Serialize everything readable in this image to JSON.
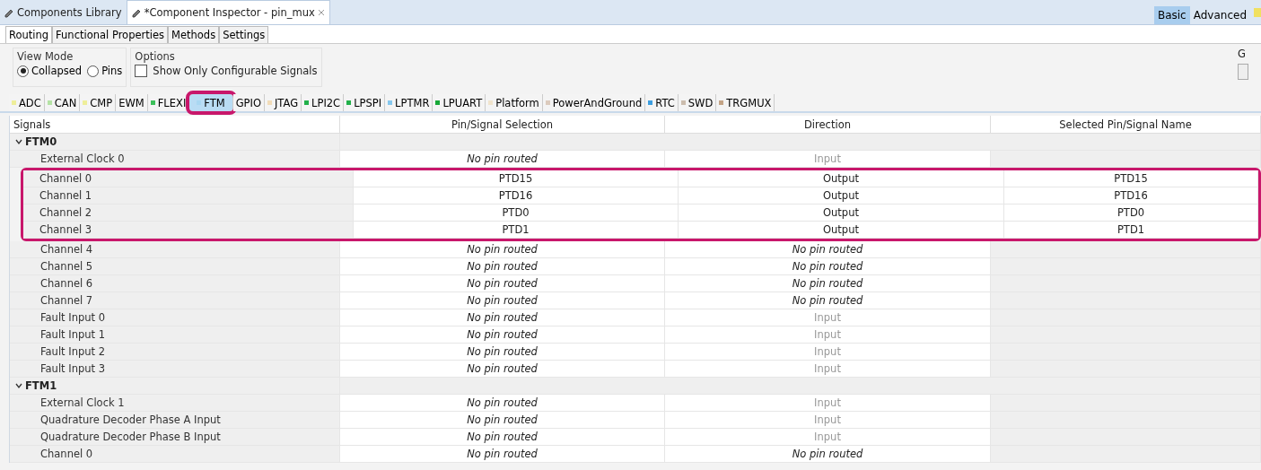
{
  "editor_tabs": [
    {
      "label": "Components Library",
      "selected": false,
      "closable": false
    },
    {
      "label": "*Component Inspector - pin_mux",
      "selected": true,
      "closable": true
    }
  ],
  "mode_buttons": [
    {
      "label": "Basic",
      "selected": true
    },
    {
      "label": "Advanced",
      "selected": false
    }
  ],
  "sub_tabs": [
    {
      "label": "Routing",
      "selected": true
    },
    {
      "label": "Functional Properties",
      "selected": false
    },
    {
      "label": "Methods",
      "selected": false
    },
    {
      "label": "Settings",
      "selected": false
    }
  ],
  "view_mode": {
    "label": "View Mode",
    "options": [
      {
        "label": "Collapsed",
        "selected": true
      },
      {
        "label": "Pins",
        "selected": false
      }
    ]
  },
  "options": {
    "label": "Options",
    "checkbox": {
      "label": "Show Only Configurable Signals",
      "checked": false
    }
  },
  "cut_group": {
    "label": "G"
  },
  "peripheral_tabs": [
    {
      "label": "ADC",
      "color": "#eeee99",
      "selected": false,
      "highlighted": false
    },
    {
      "label": "CAN",
      "color": "#b5e3a5",
      "selected": false,
      "highlighted": false
    },
    {
      "label": "CMP",
      "color": "#eeee99",
      "selected": false,
      "highlighted": false
    },
    {
      "label": "EWM",
      "selected": false,
      "highlighted": false
    },
    {
      "label": "FLEXI",
      "color": "#3cc05a",
      "selected": false,
      "highlighted": false
    },
    {
      "label": "FTM",
      "color": "#a9d7f2",
      "selected": true,
      "highlighted": true
    },
    {
      "label": "GPIO",
      "selected": false,
      "highlighted": false
    },
    {
      "label": "JTAG",
      "color": "#f2dcb8",
      "selected": false,
      "highlighted": false
    },
    {
      "label": "LPI2C",
      "color": "#22b04a",
      "selected": false,
      "highlighted": false
    },
    {
      "label": "LPSPI",
      "color": "#22b04a",
      "selected": false,
      "highlighted": false
    },
    {
      "label": "LPTMR",
      "color": "#86c8ee",
      "selected": false,
      "highlighted": false
    },
    {
      "label": "LPUART",
      "color": "#18a838",
      "selected": false,
      "highlighted": false
    },
    {
      "label": "Platform",
      "color": "#f1e4cc",
      "selected": false,
      "highlighted": false
    },
    {
      "label": "PowerAndGround",
      "color": "#dccbbd",
      "selected": false,
      "highlighted": false
    },
    {
      "label": "RTC",
      "color": "#3c9ee0",
      "selected": false,
      "highlighted": false
    },
    {
      "label": "SWD",
      "color": "#cbbcad",
      "selected": false,
      "highlighted": false
    },
    {
      "label": "TRGMUX",
      "color": "#c4a486",
      "selected": false,
      "highlighted": false
    }
  ],
  "table": {
    "columns": [
      "Signals",
      "Pin/Signal Selection",
      "Direction",
      "Selected Pin/Signal Name"
    ],
    "groups": [
      {
        "label": "FTM0",
        "expanded": true,
        "rows": [
          {
            "signal": "External Clock 0",
            "pin": "No pin routed",
            "routed": false,
            "direction": "Input",
            "direction_disabled": true,
            "highlighted": false
          },
          {
            "signal": "Channel 0",
            "pin": "PTD15",
            "routed": true,
            "direction": "Output",
            "direction_disabled": false,
            "name": "PTD15",
            "highlighted": true
          },
          {
            "signal": "Channel 1",
            "pin": "PTD16",
            "routed": true,
            "direction": "Output",
            "direction_disabled": false,
            "name": "PTD16",
            "highlighted": true
          },
          {
            "signal": "Channel 2",
            "pin": "PTD0",
            "routed": true,
            "direction": "Output",
            "direction_disabled": false,
            "name": "PTD0",
            "highlighted": true
          },
          {
            "signal": "Channel 3",
            "pin": "PTD1",
            "routed": true,
            "direction": "Output",
            "direction_disabled": false,
            "name": "PTD1",
            "highlighted": true
          },
          {
            "signal": "Channel 4",
            "pin": "No pin routed",
            "routed": false,
            "direction": "No pin routed",
            "direction_disabled": false,
            "highlighted": false
          },
          {
            "signal": "Channel 5",
            "pin": "No pin routed",
            "routed": false,
            "direction": "No pin routed",
            "direction_disabled": false,
            "highlighted": false
          },
          {
            "signal": "Channel 6",
            "pin": "No pin routed",
            "routed": false,
            "direction": "No pin routed",
            "direction_disabled": false,
            "highlighted": false
          },
          {
            "signal": "Channel 7",
            "pin": "No pin routed",
            "routed": false,
            "direction": "No pin routed",
            "direction_disabled": false,
            "highlighted": false
          },
          {
            "signal": "Fault Input 0",
            "pin": "No pin routed",
            "routed": false,
            "direction": "Input",
            "direction_disabled": true,
            "highlighted": false
          },
          {
            "signal": "Fault Input 1",
            "pin": "No pin routed",
            "routed": false,
            "direction": "Input",
            "direction_disabled": true,
            "highlighted": false
          },
          {
            "signal": "Fault Input 2",
            "pin": "No pin routed",
            "routed": false,
            "direction": "Input",
            "direction_disabled": true,
            "highlighted": false
          },
          {
            "signal": "Fault Input 3",
            "pin": "No pin routed",
            "routed": false,
            "direction": "Input",
            "direction_disabled": true,
            "highlighted": false
          }
        ]
      },
      {
        "label": "FTM1",
        "expanded": true,
        "rows": [
          {
            "signal": "External Clock 1",
            "pin": "No pin routed",
            "routed": false,
            "direction": "Input",
            "direction_disabled": true,
            "highlighted": false
          },
          {
            "signal": "Quadrature Decoder Phase A Input",
            "pin": "No pin routed",
            "routed": false,
            "direction": "Input",
            "direction_disabled": true,
            "highlighted": false
          },
          {
            "signal": "Quadrature Decoder Phase B Input",
            "pin": "No pin routed",
            "routed": false,
            "direction": "Input",
            "direction_disabled": true,
            "highlighted": false
          },
          {
            "signal": "Channel 0",
            "pin": "No pin routed",
            "routed": false,
            "direction": "No pin routed",
            "direction_disabled": false,
            "highlighted": false
          }
        ]
      }
    ]
  }
}
